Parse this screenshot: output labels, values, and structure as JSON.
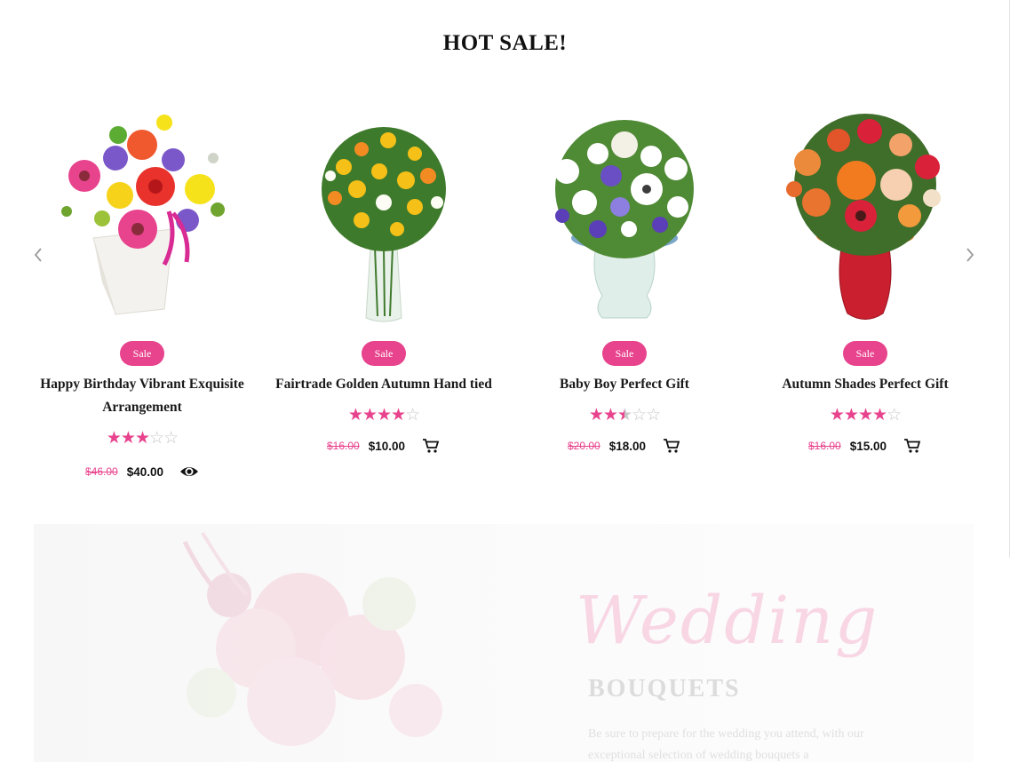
{
  "section": {
    "title": "HOT SALE!"
  },
  "colors": {
    "accent": "#e8438d",
    "text": "#111111",
    "star_empty": "#c7c7c7"
  },
  "carousel": {
    "prev_icon": "chevron-left-icon",
    "next_icon": "chevron-right-icon"
  },
  "products": [
    {
      "badge": "Sale",
      "name": "Happy Birthday Vibrant Exquisite Arrangement",
      "rating": 3,
      "old_price": "$46.00",
      "new_price": "$40.00",
      "action_icon": "eye-icon"
    },
    {
      "badge": "Sale",
      "name": "Fairtrade Golden Autumn Hand tied",
      "rating": 4,
      "old_price": "$16.00",
      "new_price": "$10.00",
      "action_icon": "cart-icon"
    },
    {
      "badge": "Sale",
      "name": "Baby Boy Perfect Gift",
      "rating": 2.5,
      "old_price": "$20.00",
      "new_price": "$18.00",
      "action_icon": "cart-icon"
    },
    {
      "badge": "Sale",
      "name": "Autumn Shades Perfect Gift",
      "rating": 4,
      "old_price": "$16.00",
      "new_price": "$15.00",
      "action_icon": "cart-icon"
    }
  ],
  "banner": {
    "script_title": "Wedding",
    "title": "BOUQUETS",
    "text": "Be sure to prepare for the wedding you attend, with our exceptional selection of wedding bouquets a"
  }
}
